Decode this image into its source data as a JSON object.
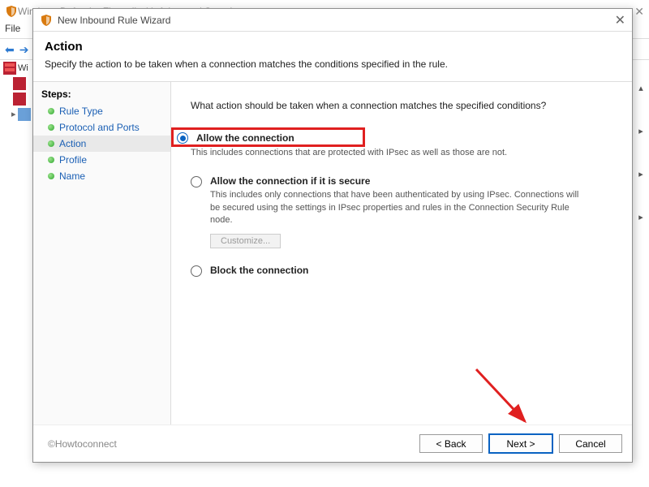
{
  "outer": {
    "title": "Windows Defender Firewall with Advanced Security",
    "menu_file": "File",
    "tree_root": "Wi"
  },
  "dialog": {
    "title": "New Inbound Rule Wizard",
    "header_title": "Action",
    "header_subtitle": "Specify the action to be taken when a connection matches the conditions specified in the rule."
  },
  "steps_title": "Steps:",
  "steps": [
    {
      "label": "Rule Type"
    },
    {
      "label": "Protocol and Ports"
    },
    {
      "label": "Action"
    },
    {
      "label": "Profile"
    },
    {
      "label": "Name"
    }
  ],
  "content": {
    "prompt": "What action should be taken when a connection matches the specified conditions?",
    "opt1_title": "Allow the connection",
    "opt1_desc": "This includes connections that are protected with IPsec as well as those are not.",
    "opt2_title": "Allow the connection if it is secure",
    "opt2_desc": "This includes only connections that have been authenticated by using IPsec.  Connections will be secured using the settings in IPsec properties and rules in the Connection Security Rule node.",
    "customize_label": "Customize...",
    "opt3_title": "Block the connection"
  },
  "footer": {
    "watermark": "©Howtoconnect",
    "back": "< Back",
    "next": "Next >",
    "cancel": "Cancel"
  }
}
